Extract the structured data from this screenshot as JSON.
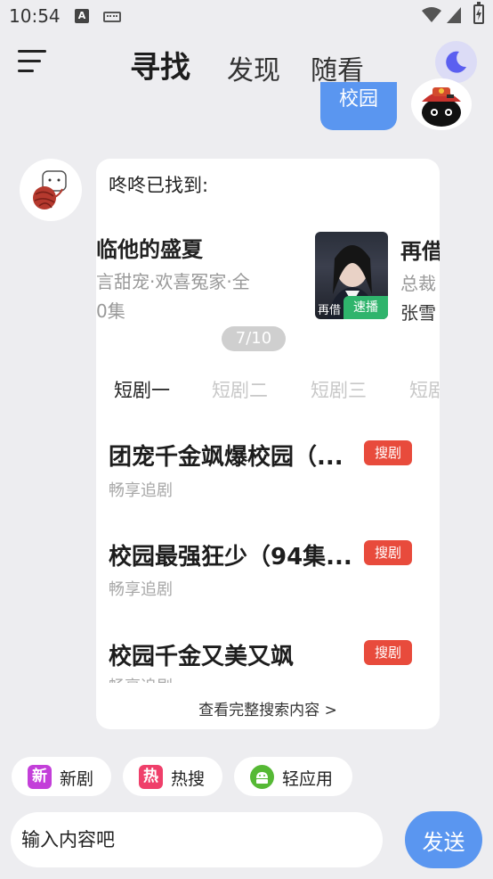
{
  "status_bar": {
    "time": "10:54"
  },
  "header": {
    "tabs": [
      {
        "label": "寻找"
      },
      {
        "label": "发现"
      },
      {
        "label": "随看"
      }
    ]
  },
  "user_message": {
    "text": "校园"
  },
  "bot": {
    "greeting": "咚咚已找到:",
    "carousel": {
      "prev_title": "临他的盛夏",
      "prev_meta_line1": "言甜宠·欢喜冤家·全",
      "prev_meta_line2": "0集",
      "current_badge": "速播",
      "current_poster_text": "再借",
      "current_title": "再借",
      "current_meta_line1": "总裁",
      "current_meta_line2": "张雪",
      "pager": "7/10"
    },
    "drama_tabs": [
      "短剧一",
      "短剧二",
      "短剧三",
      "短剧"
    ],
    "results": [
      {
        "title": "团宠千金飒爆校园（...",
        "sub": "畅享追剧",
        "badge": "搜剧"
      },
      {
        "title": "校园最强狂少（94集...",
        "sub": "畅享追剧",
        "badge": "搜剧"
      },
      {
        "title": "校园千金又美又飒",
        "sub": "畅享追剧",
        "badge": "搜剧"
      }
    ],
    "view_full": "查看完整搜索内容 >"
  },
  "quick_chips": [
    {
      "icon_text": "新",
      "label": "新剧",
      "color": "#c33fd9"
    },
    {
      "icon_text": "热",
      "label": "热搜",
      "color": "#ef3f6a"
    },
    {
      "icon_text": "",
      "label": "轻应用",
      "color": "#56b935"
    }
  ],
  "input": {
    "placeholder": "输入内容吧"
  },
  "send_label": "发送",
  "colors": {
    "accent": "#5a96f0",
    "badge_red": "#e84b3c",
    "badge_green": "#2fb46c"
  }
}
